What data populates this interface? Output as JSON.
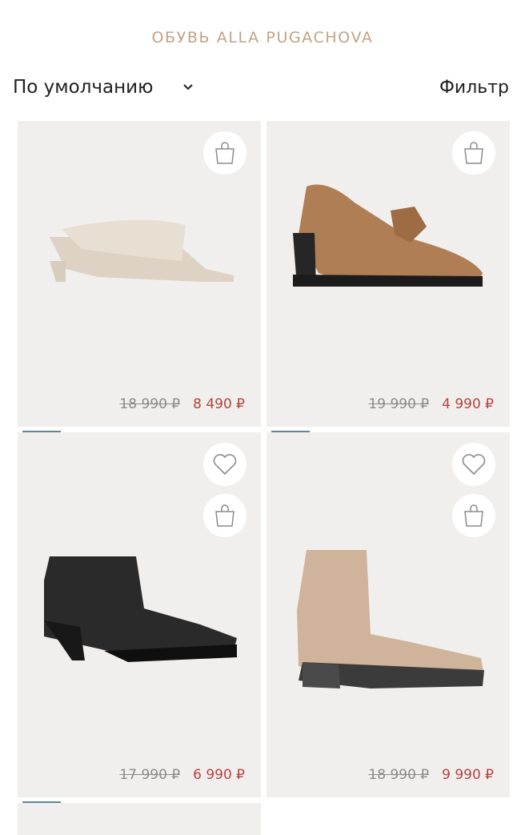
{
  "page": {
    "title": "ОБУВЬ ALLA PUGACHOVA"
  },
  "toolbar": {
    "sort_label": "По умолчанию",
    "filter_label": "Фильтр"
  },
  "products": [
    {
      "name": "mule",
      "old_price": "18 990 ₽",
      "new_price": "8 490 ₽",
      "has_wishlist": false,
      "slide_count": 5,
      "active_slide": 1
    },
    {
      "name": "loafer",
      "old_price": "19 990 ₽",
      "new_price": "4 990 ₽",
      "has_wishlist": false,
      "slide_count": 5,
      "active_slide": 1
    },
    {
      "name": "black-boot",
      "old_price": "17 990 ₽",
      "new_price": "6 990 ₽",
      "has_wishlist": true,
      "slide_count": 5,
      "active_slide": 1
    },
    {
      "name": "beige-boot",
      "old_price": "18 990 ₽",
      "new_price": "9 990 ₽",
      "has_wishlist": true,
      "slide_count": 5,
      "active_slide": 1
    }
  ],
  "colors": {
    "title": "#c2a284",
    "price_new": "#b5433e",
    "price_old": "#8a8a8a",
    "card_bg": "#f1efed",
    "active_dot": "#5f8597"
  },
  "icons": {
    "cart": "shopping-bag-icon",
    "wishlist": "heart-icon",
    "sort_chevron": "chevron-down-icon"
  }
}
